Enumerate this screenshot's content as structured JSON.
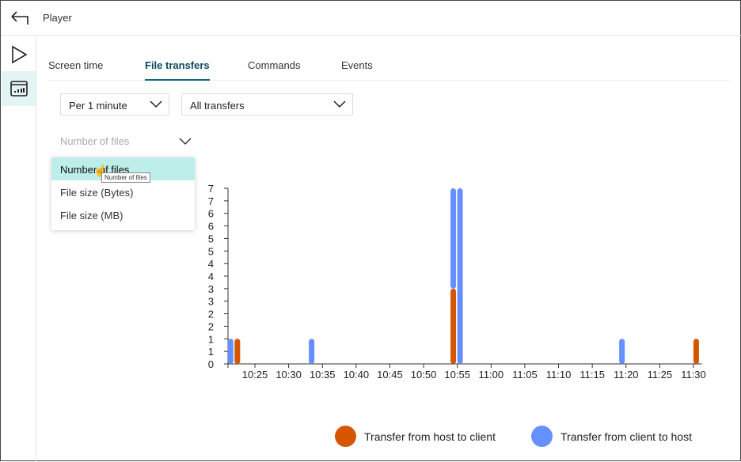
{
  "header": {
    "title": "Player",
    "back_icon": "back-arrow-icon"
  },
  "sidebar": {
    "items": [
      {
        "icon": "play-icon",
        "active": false
      },
      {
        "icon": "analytics-icon",
        "active": true
      }
    ]
  },
  "tabs": [
    {
      "label": "Screen time",
      "active": false
    },
    {
      "label": "File transfers",
      "active": true
    },
    {
      "label": "Commands",
      "active": false
    },
    {
      "label": "Events",
      "active": false
    }
  ],
  "filters": {
    "interval": "Per 1 minute",
    "type": "All transfers"
  },
  "metric": {
    "selected": "Number of files",
    "options": [
      "Number of files",
      "File size (Bytes)",
      "File size (MB)"
    ],
    "highlighted": 0,
    "tooltip": "Number of files"
  },
  "colors": {
    "host_to_client": "#d55500",
    "client_to_host": "#6690ff",
    "menu_highlight": "#bdeee9",
    "active_tab": "#0a4a5a"
  },
  "chart_data": {
    "type": "bar",
    "stacked": true,
    "xlabel": "",
    "ylabel": "",
    "ylim": [
      0,
      7
    ],
    "yticks": [
      "0",
      "1",
      "1",
      "2",
      "2",
      "3",
      "3",
      "4",
      "4",
      "5",
      "5",
      "6",
      "6",
      "7",
      "7"
    ],
    "xticks": [
      "10:25",
      "10:30",
      "10:35",
      "10:40",
      "10:45",
      "10:50",
      "10:55",
      "11:00",
      "11:05",
      "11:10",
      "11:15",
      "11:20",
      "11:25",
      "11:30"
    ],
    "xlim": [
      "10:21",
      "11:31"
    ],
    "series": [
      {
        "name": "Transfer from host to client",
        "color": "#d55500",
        "points": [
          {
            "x": "10:22",
            "y": 1
          },
          {
            "x": "10:54",
            "y": 3
          },
          {
            "x": "11:30",
            "y": 1
          }
        ]
      },
      {
        "name": "Transfer from client to host",
        "color": "#6690ff",
        "points": [
          {
            "x": "10:21",
            "y": 1
          },
          {
            "x": "10:33",
            "y": 1
          },
          {
            "x": "10:54",
            "y": 4
          },
          {
            "x": "10:55",
            "y": 7
          },
          {
            "x": "11:19",
            "y": 1
          }
        ]
      }
    ],
    "legend": "bottom"
  }
}
